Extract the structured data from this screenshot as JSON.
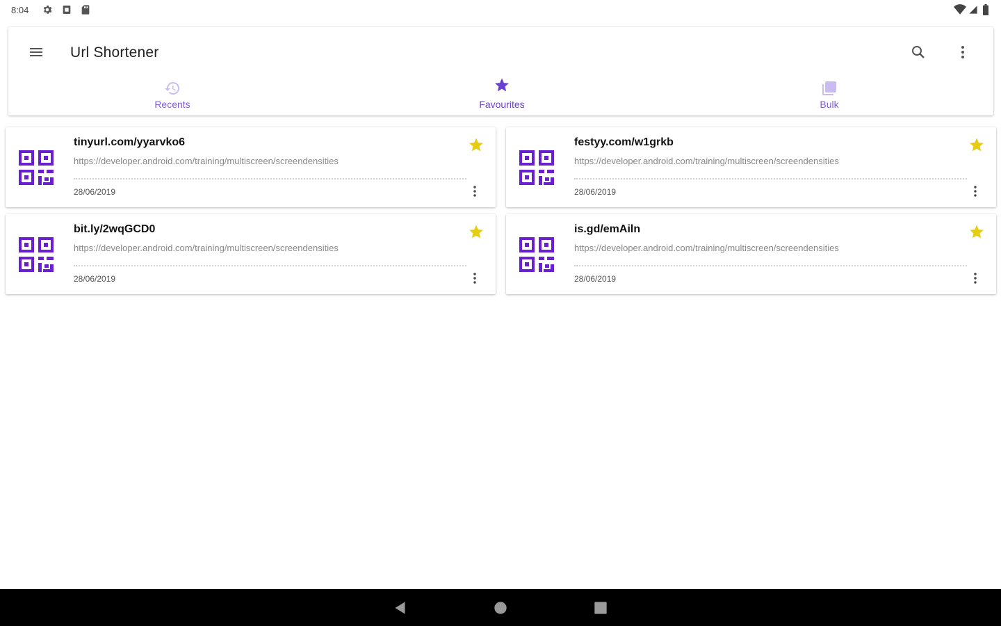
{
  "status_bar": {
    "time": "8:04",
    "left_icons": [
      "settings-icon",
      "sim-icon",
      "sd-card-icon"
    ],
    "right_icons": [
      "wifi-icon",
      "signal-icon",
      "battery-icon"
    ]
  },
  "app_bar": {
    "title": "Url Shortener",
    "accent_color": "#6a3fd6"
  },
  "tabs": [
    {
      "label": "Recents",
      "icon": "history-icon",
      "selected": false
    },
    {
      "label": "Favourites",
      "icon": "star-icon",
      "selected": true
    },
    {
      "label": "Bulk",
      "icon": "library-icon",
      "selected": false
    }
  ],
  "cards": [
    {
      "short_url": "tinyurl.com/yyarvko6",
      "long_url": "https://developer.android.com/training/multiscreen/screendensities",
      "date": "28/06/2019",
      "favourite": true
    },
    {
      "short_url": "festyy.com/w1grkb",
      "long_url": "https://developer.android.com/training/multiscreen/screendensities",
      "date": "28/06/2019",
      "favourite": true
    },
    {
      "short_url": "bit.ly/2wqGCD0",
      "long_url": "https://developer.android.com/training/multiscreen/screendensities",
      "date": "28/06/2019",
      "favourite": true
    },
    {
      "short_url": "is.gd/emAiln",
      "long_url": "https://developer.android.com/training/multiscreen/screendensities",
      "date": "28/06/2019",
      "favourite": true
    }
  ],
  "colors": {
    "accent": "#6a3fd6",
    "star": "#e6cc12",
    "nav_bar": "#000000"
  },
  "nav_bar": [
    "back-icon",
    "home-icon",
    "recents-icon"
  ]
}
